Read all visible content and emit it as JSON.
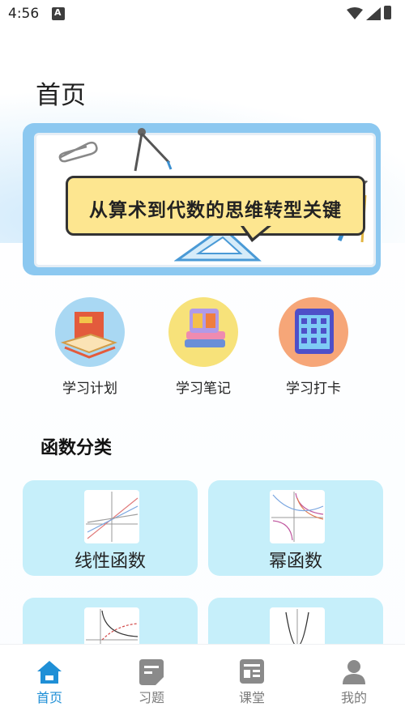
{
  "status": {
    "time": "4:56"
  },
  "page": {
    "title": "首页"
  },
  "banner": {
    "headline": "从算术到代数的思维转型关键"
  },
  "shortcuts": [
    {
      "label": "学习计划",
      "icon": "book-icon"
    },
    {
      "label": "学习笔记",
      "icon": "notebook-icon"
    },
    {
      "label": "学习打卡",
      "icon": "calendar-icon"
    }
  ],
  "section": {
    "title": "函数分类"
  },
  "cards": [
    {
      "label": "线性函数"
    },
    {
      "label": "幂函数"
    },
    {
      "label": ""
    },
    {
      "label": ""
    }
  ],
  "tabs": [
    {
      "label": "首页",
      "icon": "home-icon",
      "active": true
    },
    {
      "label": "习题",
      "icon": "exercise-icon",
      "active": false
    },
    {
      "label": "课堂",
      "icon": "classroom-icon",
      "active": false
    },
    {
      "label": "我的",
      "icon": "profile-icon",
      "active": false
    }
  ],
  "colors": {
    "accent": "#1f8fd6",
    "tab_inactive": "#7b7b7b",
    "card_bg": "#c6effa",
    "banner_bg": "#8cc8f0",
    "bubble": "#fde690"
  }
}
